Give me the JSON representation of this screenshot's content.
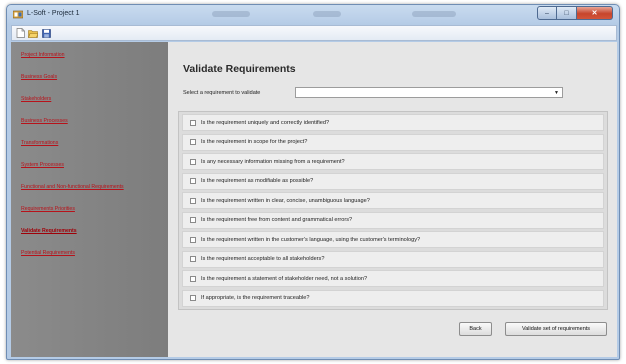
{
  "window": {
    "title": "L-Soft - Project 1",
    "minimize_label": "–",
    "maximize_label": "□",
    "close_label": "✕"
  },
  "toolbar": {
    "icons": [
      "new-document-icon",
      "open-folder-icon",
      "save-icon"
    ]
  },
  "sidebar": {
    "items": [
      {
        "label": "Project Information",
        "active": false
      },
      {
        "label": "Business Goals",
        "active": false
      },
      {
        "label": "Stakeholders",
        "active": false
      },
      {
        "label": "Business Processes",
        "active": false
      },
      {
        "label": "Transformations",
        "active": false
      },
      {
        "label": "System Processes",
        "active": false
      },
      {
        "label": "Functional and Non-functional Requirements",
        "active": false
      },
      {
        "label": "Requirements Priorities",
        "active": false
      },
      {
        "label": "Validate Requirements",
        "active": true
      },
      {
        "label": "Potential Requirements",
        "active": false
      }
    ]
  },
  "main": {
    "heading": "Validate Requirements",
    "select_label": "Select a requirement to validate",
    "select_value": "",
    "checklist": [
      "Is the requirement uniquely and correctly identified?",
      "Is the requirement in scope for the project?",
      "Is any necessary information missing from a requirement?",
      "Is the requirement as modifiable as possible?",
      "Is the requirement written in clear, concise, unambiguous language?",
      "Is the requirement free from content and grammatical errors?",
      "Is the requirement written in the customer's language, using the customer's terminology?",
      "Is the requirement acceptable to all stakeholders?",
      "Is the requirement a statement of stakeholder need, not a solution?",
      "If appropriate, is the requirement traceable?"
    ],
    "back_label": "Back",
    "validate_label": "Validate set of requirements"
  },
  "colors": {
    "sidebar_bg": "#828282",
    "link": "#b8121a",
    "content_bg": "#e6e6e6",
    "titlebar": "#b4cbe6"
  }
}
